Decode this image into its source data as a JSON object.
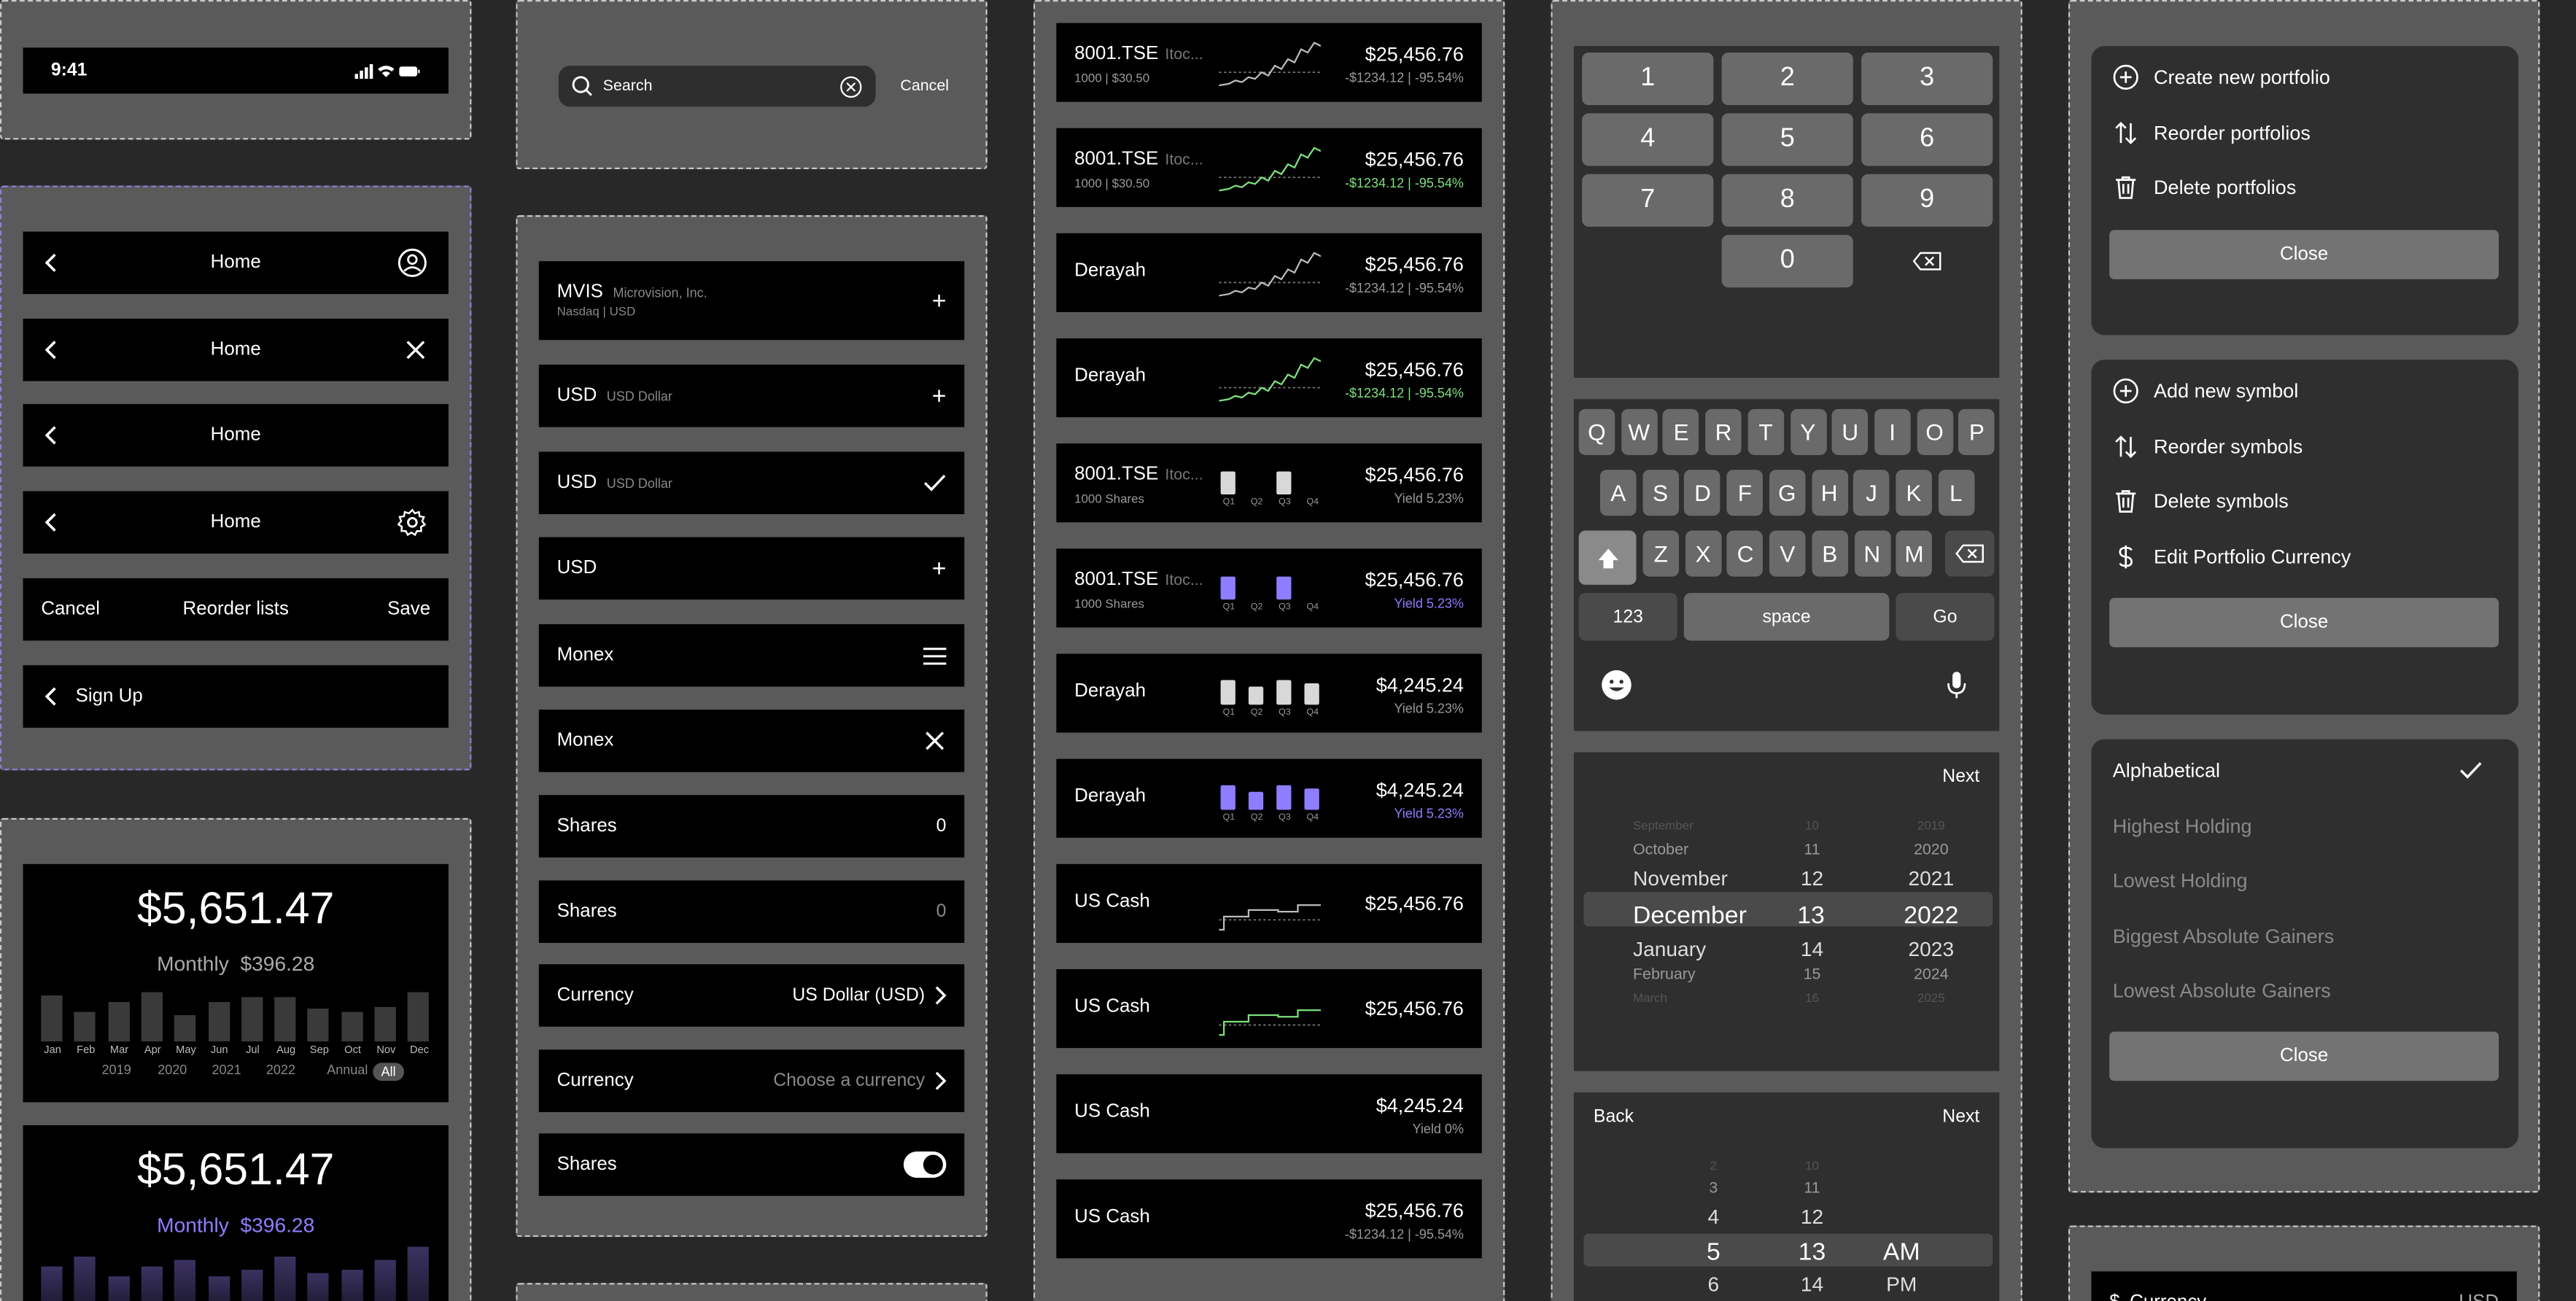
{
  "status_bar": {
    "time": "9:41"
  },
  "nav_bars": [
    {
      "title": "Home",
      "right_icon": "person-icon"
    },
    {
      "title": "Home",
      "right_icon": "close-icon"
    },
    {
      "title": "Home",
      "right_icon": ""
    },
    {
      "title": "Home",
      "right_icon": "gear-icon"
    }
  ],
  "reorder_bar": {
    "cancel": "Cancel",
    "title": "Reorder lists",
    "save": "Save"
  },
  "signup_bar": {
    "title": "Sign Up"
  },
  "portfolio_cards": [
    {
      "total": "$5,651.47",
      "period": "Monthly",
      "amount": "$396.28",
      "months": [
        "Jan",
        "Feb",
        "Mar",
        "Apr",
        "May",
        "Jun",
        "Jul",
        "Aug",
        "Sep",
        "Oct",
        "Nov",
        "Dec"
      ],
      "bar_levels": [
        0.75,
        0.48,
        0.63,
        0.78,
        0.43,
        0.63,
        0.7,
        0.7,
        0.53,
        0.48,
        0.55,
        0.8
      ],
      "years": [
        "2019",
        "2020",
        "2021",
        "2022",
        "Annual",
        "All"
      ],
      "selected_year": "All"
    },
    {
      "total": "$5,651.47",
      "period": "Monthly",
      "amount": "$396.28",
      "bar_levels": [
        0.6,
        0.75,
        0.45,
        0.6,
        0.7,
        0.45,
        0.55,
        0.75,
        0.5,
        0.55,
        0.7,
        0.9
      ]
    }
  ],
  "search": {
    "placeholder": "Search",
    "cancel": "Cancel"
  },
  "form_rows": [
    {
      "label": "MVIS",
      "sub": "Microvision, Inc.",
      "sub2": "Nasdaq | USD",
      "right": "+"
    },
    {
      "label": "USD",
      "sub": "USD Dollar",
      "right": "+"
    },
    {
      "label": "USD",
      "sub": "USD Dollar",
      "right": "check-icon"
    },
    {
      "label": "USD",
      "sub": "",
      "right": "+"
    },
    {
      "label": "Monex",
      "right": "menu-icon"
    },
    {
      "label": "Monex",
      "right": "close-icon"
    },
    {
      "label": "Shares",
      "right": "0"
    },
    {
      "label": "Shares",
      "right": "0"
    },
    {
      "label": "Currency",
      "right": "US Dollar (USD)"
    },
    {
      "label": "Currency",
      "right": "Choose a currency"
    },
    {
      "label": "Shares",
      "right": "toggle-on"
    }
  ],
  "ticker_rows": [
    {
      "name": "8001.TSE",
      "company": "Itoc...",
      "meta": "1000 | $30.50",
      "chart": "line",
      "price": "$25,456.76",
      "change": "-$1234.12 | -95.54%",
      "accent": "grey"
    },
    {
      "name": "8001.TSE",
      "company": "Itoc...",
      "meta": "1000 | $30.50",
      "chart": "line",
      "price": "$25,456.76",
      "change": "-$1234.12 | -95.54%",
      "accent": "green"
    },
    {
      "name": "Derayah",
      "chart": "line",
      "price": "$25,456.76",
      "change": "-$1234.12 | -95.54%",
      "accent": "grey"
    },
    {
      "name": "Derayah",
      "chart": "line",
      "price": "$25,456.76",
      "change": "-$1234.12 | -95.54%",
      "accent": "green"
    },
    {
      "name": "8001.TSE",
      "company": "Itoc...",
      "meta": "1000 Shares",
      "chart": "q2",
      "price": "$25,456.76",
      "change": "Yield 5.23%",
      "accent": "grey"
    },
    {
      "name": "8001.TSE",
      "company": "Itoc...",
      "meta": "1000 Shares",
      "chart": "q2",
      "price": "$25,456.76",
      "change": "Yield 5.23%",
      "accent": "purple"
    },
    {
      "name": "Derayah",
      "chart": "q4",
      "price": "$4,245.24",
      "change": "Yield 5.23%",
      "accent": "grey"
    },
    {
      "name": "Derayah",
      "chart": "q4",
      "price": "$4,245.24",
      "change": "Yield 5.23%",
      "accent": "purple"
    },
    {
      "name": "US Cash",
      "chart": "step",
      "price": "$25,456.76",
      "change": "",
      "accent": "grey"
    },
    {
      "name": "US Cash",
      "chart": "step",
      "price": "$25,456.76",
      "change": "",
      "accent": "green"
    },
    {
      "name": "US Cash",
      "chart": "none",
      "price": "$4,245.24",
      "change": "Yield 0%",
      "accent": "grey"
    },
    {
      "name": "US Cash",
      "chart": "none",
      "price": "$25,456.76",
      "change": "-$1234.12 | -95.54%",
      "accent": "grey"
    }
  ],
  "quarters": [
    "Q1",
    "Q2",
    "Q3",
    "Q4"
  ],
  "numpad": {
    "keys": [
      "1",
      "2",
      "3",
      "4",
      "5",
      "6",
      "7",
      "8",
      "9",
      "0"
    ]
  },
  "keyboard": {
    "row1": [
      "Q",
      "W",
      "E",
      "R",
      "T",
      "Y",
      "U",
      "I",
      "O",
      "P"
    ],
    "row2": [
      "A",
      "S",
      "D",
      "F",
      "G",
      "H",
      "J",
      "K",
      "L"
    ],
    "row3": [
      "Z",
      "X",
      "C",
      "V",
      "B",
      "N",
      "M"
    ],
    "numbers": "123",
    "space": "space",
    "go": "Go"
  },
  "date_picker": {
    "next": "Next",
    "months": [
      "September",
      "October",
      "November",
      "December",
      "January",
      "February",
      "March"
    ],
    "days": [
      "10",
      "11",
      "12",
      "13",
      "14",
      "15",
      "16"
    ],
    "years": [
      "2019",
      "2020",
      "2021",
      "2022",
      "2023",
      "2024",
      "2025"
    ]
  },
  "time_picker": {
    "back": "Back",
    "next": "Next",
    "hours": [
      "2",
      "3",
      "4",
      "5",
      "6"
    ],
    "minutes": [
      "10",
      "11",
      "12",
      "13",
      "14"
    ],
    "periods": [
      "AM",
      "PM"
    ]
  },
  "portfolio_menu": {
    "items": [
      "Create new portfolio",
      "Reorder portfolios",
      "Delete portfolios"
    ],
    "close": "Close"
  },
  "symbol_menu": {
    "items": [
      "Add new symbol",
      "Reorder symbols",
      "Delete symbols",
      "Edit Portfolio Currency"
    ],
    "close": "Close"
  },
  "sort_menu": {
    "items": [
      "Alphabetical",
      "Highest Holding",
      "Lowest Holding",
      "Biggest Absolute Gainers",
      "Lowest Absolute Gainers"
    ],
    "selected": "Alphabetical",
    "close": "Close"
  },
  "bottom_currency": {
    "label": "Currency",
    "value": "USD"
  }
}
